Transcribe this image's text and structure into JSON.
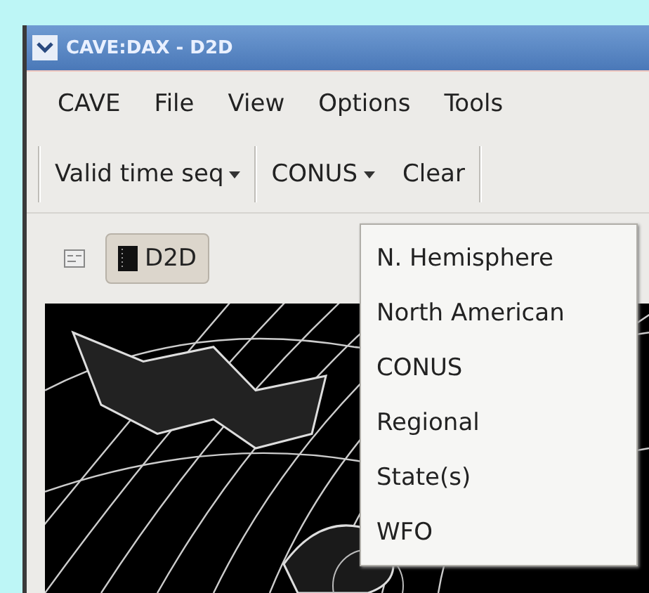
{
  "window": {
    "title": "CAVE:DAX - D2D"
  },
  "menu_bar": [
    "CAVE",
    "File",
    "View",
    "Options",
    "Tools"
  ],
  "toolbar": [
    {
      "kind": "dropdown",
      "label": "Valid time seq"
    },
    {
      "kind": "dropdown",
      "label": "CONUS"
    },
    {
      "kind": "button",
      "label": "Clear"
    }
  ],
  "editor_tabs": [
    {
      "label": "D2D",
      "selected": true
    }
  ],
  "map": {
    "kind": "picture"
  },
  "dropdown_menu": {
    "items": [
      "N. Hemisphere",
      "North American",
      "CONUS",
      "Regional",
      "State(s)",
      "WFO"
    ]
  }
}
